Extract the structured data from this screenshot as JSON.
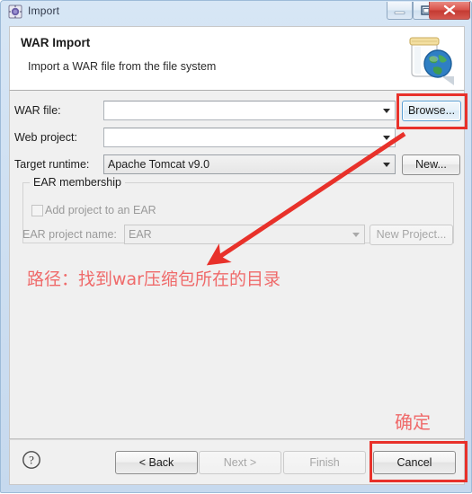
{
  "window": {
    "title": "Import",
    "icon": "import-icon",
    "controls": {
      "minimize": "minimize-icon",
      "maximize": "restore-icon",
      "close": "close-icon"
    }
  },
  "header": {
    "title": "WAR Import",
    "description": "Import a WAR file from the file system",
    "icon": "war-jar-globe-icon"
  },
  "form": {
    "war_file": {
      "label": "WAR file:",
      "value": "",
      "placeholder": ""
    },
    "web_project": {
      "label": "Web project:",
      "value": "",
      "placeholder": ""
    },
    "target_runtime": {
      "label": "Target runtime:",
      "value": "Apache Tomcat v9.0"
    },
    "browse_button": "Browse...",
    "new_button": "New..."
  },
  "ear_group": {
    "legend": "EAR membership",
    "checkbox_label": "Add project to an EAR",
    "checked": false,
    "project_name_label": "EAR project name:",
    "project_name_value": "EAR",
    "new_project_button": "New Project..."
  },
  "footer": {
    "help_icon": "help-question-icon",
    "back_button": "< Back",
    "next_button": "Next >",
    "finish_button": "Finish",
    "cancel_button": "Cancel"
  },
  "annotations": {
    "path_note": "路径：找到war压缩包所在的目录",
    "confirm_note": "确定",
    "highlight_color": "#e8312a",
    "note_color": "#ef6a6a",
    "arrow_color": "#e8312a"
  }
}
